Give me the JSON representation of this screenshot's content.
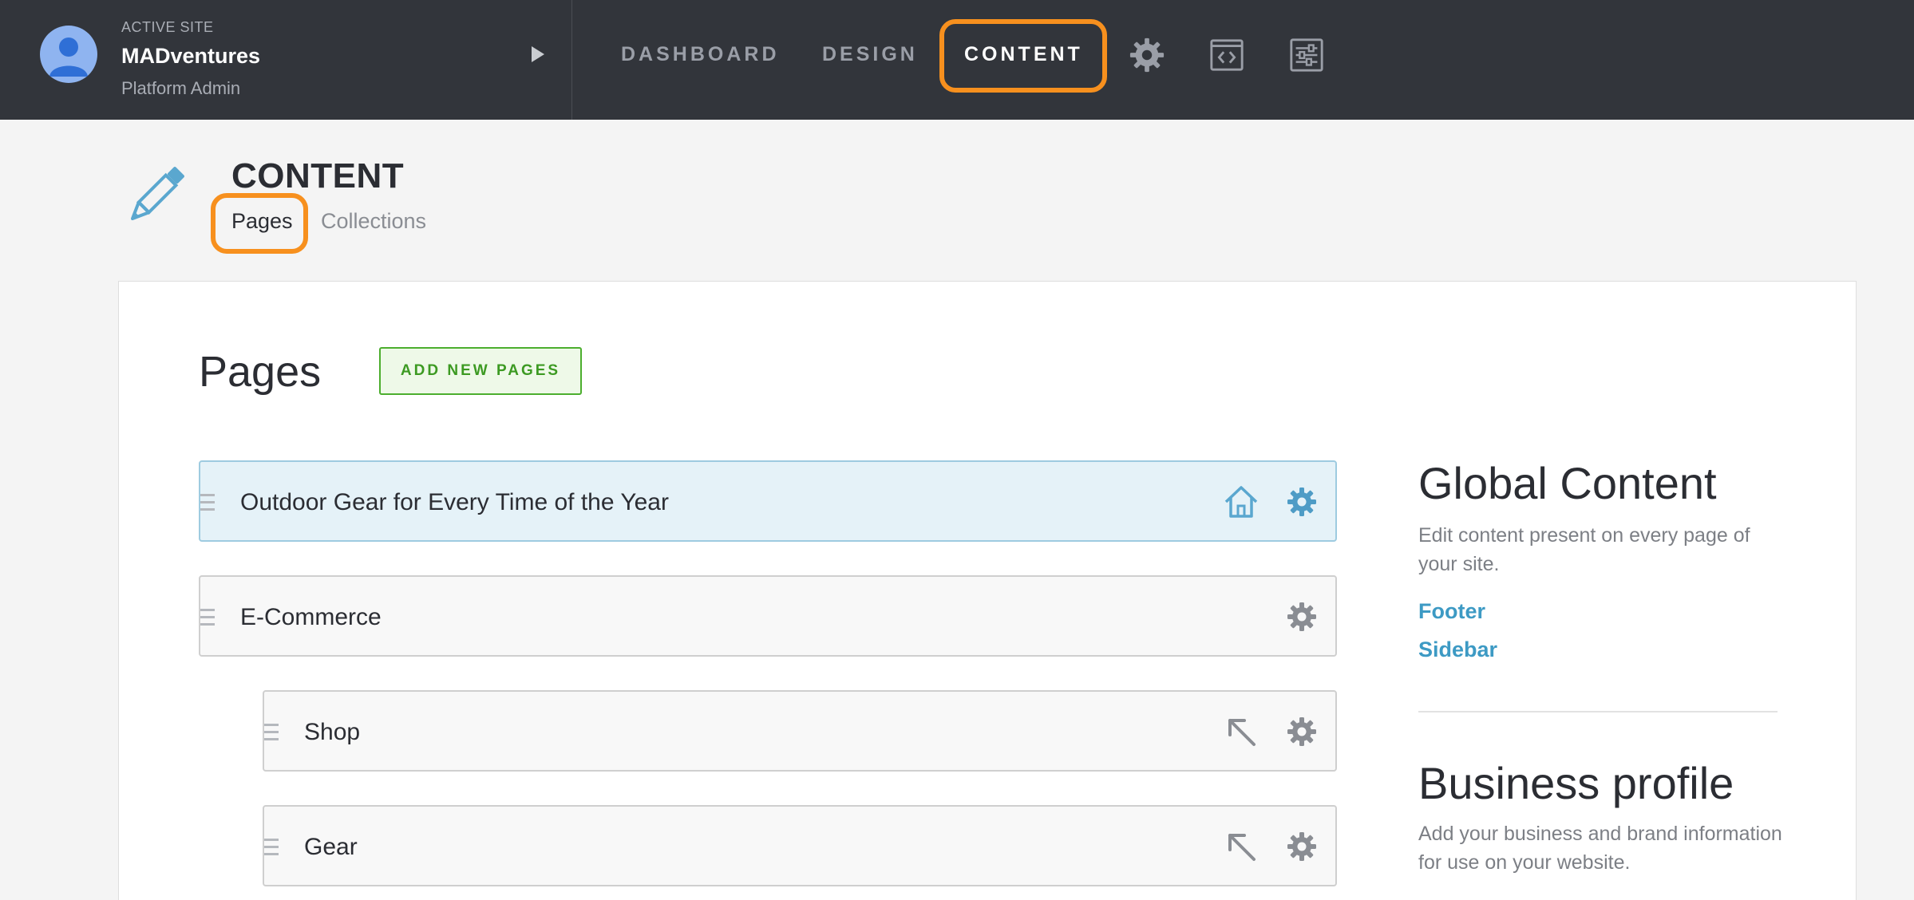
{
  "site": {
    "kicker": "ACTIVE SITE",
    "name": "MADventures",
    "role": "Platform Admin"
  },
  "nav": {
    "dashboard": "DASHBOARD",
    "design": "DESIGN",
    "content": "CONTENT",
    "icons": [
      "gear-icon",
      "code-window-icon",
      "sliders-icon"
    ]
  },
  "header": {
    "title": "CONTENT",
    "tabs": [
      "Pages",
      "Collections"
    ]
  },
  "pages": {
    "heading": "Pages",
    "add_button": "ADD NEW PAGES",
    "rows": [
      {
        "label": "Outdoor Gear for Every Time of the Year",
        "icons": [
          "home-icon",
          "gear-icon"
        ]
      },
      {
        "label": "E-Commerce",
        "icons": [
          "gear-icon"
        ]
      },
      {
        "label": "Shop",
        "icons": [
          "arrow-up-left-icon",
          "gear-icon"
        ]
      },
      {
        "label": "Gear",
        "icons": [
          "arrow-up-left-icon",
          "gear-icon"
        ]
      }
    ]
  },
  "global_content": {
    "title": "Global Content",
    "description": "Edit content present on every page of your site.",
    "links": [
      "Footer",
      "Sidebar"
    ]
  },
  "business_profile": {
    "title": "Business profile",
    "description": "Add your business and brand information for use on your website."
  },
  "colors": {
    "topbar": "#32353b",
    "highlight": "#f7901e",
    "accent_blue": "#3d9ac4",
    "add_green": "#3c9a22",
    "home_row": "#e5f2f8"
  }
}
